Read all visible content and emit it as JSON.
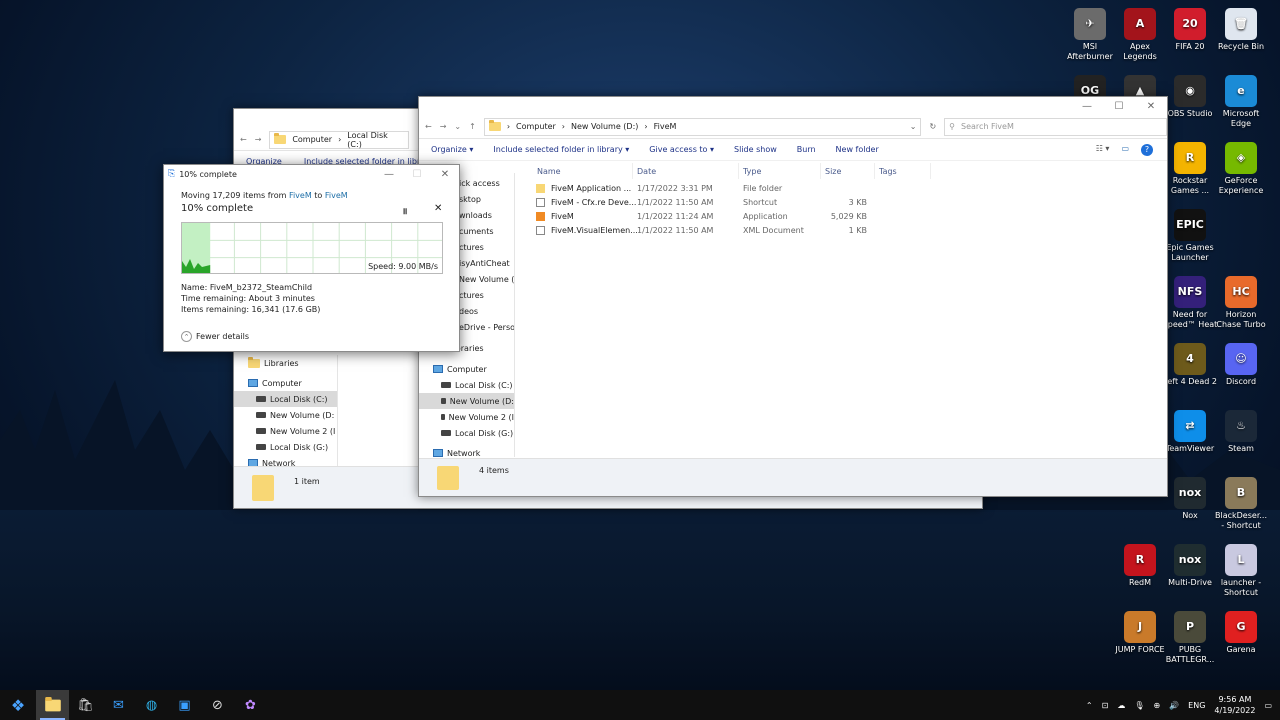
{
  "desktop_icons": [
    {
      "label": "MSI Afterburner",
      "color": "#6b6b6b",
      "glyph": "✈"
    },
    {
      "label": "Apex Legends",
      "color": "#a3141b",
      "glyph": "A"
    },
    {
      "label": "FIFA 20",
      "color": "#d11d2c",
      "glyph": "20"
    },
    {
      "label": "Recycle Bin",
      "color": "#dfe6ef",
      "glyph": "🗑"
    },
    {
      "label": "",
      "color": "#222",
      "glyph": "OG"
    },
    {
      "label": "",
      "color": "#333",
      "glyph": "▲"
    },
    {
      "label": "OBS Studio",
      "color": "#2b2b2b",
      "glyph": "◉"
    },
    {
      "label": "Microsoft Edge",
      "color": "#1b8bd6",
      "glyph": "e"
    },
    {
      "label": "Rockstar Games ...",
      "color": "#f4b400",
      "glyph": "R"
    },
    {
      "label": "GeForce Experience",
      "color": "#76b900",
      "glyph": "◈"
    },
    {
      "label": "Epic Games Launcher",
      "color": "#111",
      "glyph": "EPIC"
    },
    {
      "label": "Need for Speed™ Heat",
      "color": "#34207a",
      "glyph": "NFS"
    },
    {
      "label": "Horizon Chase Turbo",
      "color": "#e86a2b",
      "glyph": "HC"
    },
    {
      "label": "Left 4 Dead 2",
      "color": "#6d5a1b",
      "glyph": "4"
    },
    {
      "label": "Discord",
      "color": "#5865f2",
      "glyph": "☺"
    },
    {
      "label": "TeamViewer",
      "color": "#0e8ee9",
      "glyph": "⇄"
    },
    {
      "label": "Steam",
      "color": "#1b2838",
      "glyph": "♨"
    },
    {
      "label": "Nox",
      "color": "#202a30",
      "glyph": "nox"
    },
    {
      "label": "BlackDeser... - Shortcut",
      "color": "#8a7a5a",
      "glyph": "B"
    },
    {
      "label": "RedM",
      "color": "#c4141d",
      "glyph": "R"
    },
    {
      "label": "Multi-Drive",
      "color": "#1f2d30",
      "glyph": "nox"
    },
    {
      "label": "launcher - Shortcut",
      "color": "#c9c9e0",
      "glyph": "L"
    },
    {
      "label": "JUMP FORCE",
      "color": "#c97a2a",
      "glyph": "J"
    },
    {
      "label": "PUBG BATTLEGR...",
      "color": "#4a4a3a",
      "glyph": "P"
    },
    {
      "label": "Garena",
      "color": "#e02020",
      "glyph": "G"
    }
  ],
  "back_window": {
    "address": [
      "Computer",
      "Local Disk (C:)"
    ],
    "toolbar": [
      "Organize",
      "Include selected folder in library"
    ],
    "nav": [
      "Libraries",
      "Computer",
      "Local Disk (C:)",
      "New Volume (D:",
      "New Volume 2 (I",
      "Local Disk (G:)",
      "Network"
    ],
    "status": "1 item"
  },
  "front_window": {
    "address": [
      "Computer",
      "New Volume (D:)",
      "FiveM"
    ],
    "search_placeholder": "Search FiveM",
    "toolbar": [
      "Organize",
      "Include selected folder in library",
      "Give access to",
      "Slide show",
      "Burn",
      "New folder"
    ],
    "nav": [
      "ick access",
      "sktop",
      "wnloads",
      "cuments",
      "ctures",
      "isyAntiCheat",
      "New Volume (D:",
      "ctures",
      "deos",
      "eDrive - Persor",
      "Libraries",
      "Computer",
      "Local Disk (C:)",
      "New Volume (D:",
      "New Volume 2 (I",
      "Local Disk (G:)",
      "Network"
    ],
    "columns": [
      "Name",
      "Date",
      "Type",
      "Size",
      "Tags"
    ],
    "files": [
      {
        "name": "FiveM Application ...",
        "date": "1/17/2022 3:31 PM",
        "type": "File folder",
        "size": ""
      },
      {
        "name": "FiveM - Cfx.re Deve...",
        "date": "1/1/2022 11:50 AM",
        "type": "Shortcut",
        "size": "3 KB"
      },
      {
        "name": "FiveM",
        "date": "1/1/2022 11:24 AM",
        "type": "Application",
        "size": "5,029 KB"
      },
      {
        "name": "FiveM.VisualElemen...",
        "date": "1/1/2022 11:50 AM",
        "type": "XML Document",
        "size": "1 KB"
      }
    ],
    "status": "4 items"
  },
  "progress_dialog": {
    "title": "10% complete",
    "moving_prefix": "Moving 17,209 items from ",
    "from": "FiveM",
    "to_word": " to ",
    "to": "FiveM",
    "heading": "10% complete",
    "percent": 10,
    "speed": "Speed: 9.00 MB/s",
    "name_line": "Name:  FiveM_b2372_SteamChild",
    "time_line": "Time remaining:  About 3 minutes",
    "items_line": "Items remaining:  16,341 (17.6 GB)",
    "fewer": "Fewer details",
    "accent": "#2aa52a"
  },
  "taskbar": {
    "time": "9:56 AM",
    "date": "4/19/2022",
    "lang": "ENG"
  }
}
